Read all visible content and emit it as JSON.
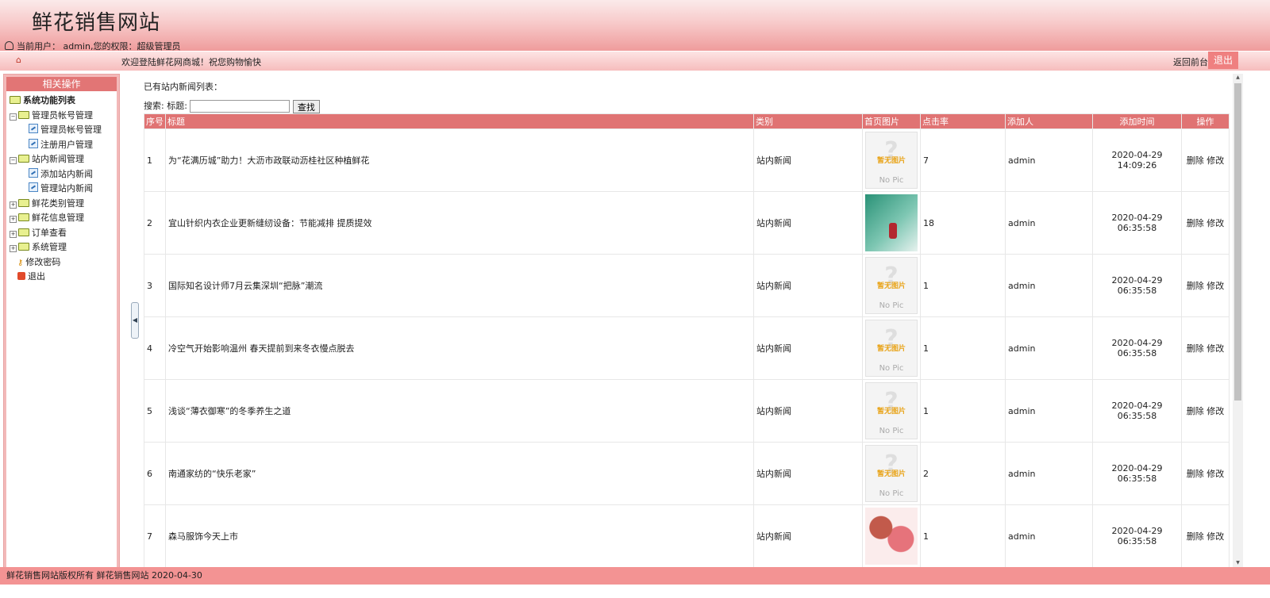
{
  "header": {
    "site_title": "鲜花销售网站",
    "user_info": "当前用户： admin,您的权限：超级管理员"
  },
  "nav": {
    "home_icon": "⌂",
    "welcome": "欢迎登陆鲜花网商城！祝您购物愉快",
    "back_front": "返回前台",
    "logout": "退出"
  },
  "sidebar": {
    "title": "相关操作",
    "root": "系统功能列表",
    "groups": [
      {
        "label": "管理员帐号管理",
        "children": [
          "管理员帐号管理",
          "注册用户管理"
        ]
      },
      {
        "label": "站内新闻管理",
        "children": [
          "添加站内新闻",
          "管理站内新闻"
        ]
      },
      {
        "label": "鲜花类别管理"
      },
      {
        "label": "鲜花信息管理"
      },
      {
        "label": "订单查看"
      },
      {
        "label": "系统管理"
      }
    ],
    "change_password": "修改密码",
    "exit": "退出"
  },
  "main": {
    "list_title": "已有站内新闻列表：",
    "search_label": "搜索: 标题:",
    "search_value": "",
    "search_button": "查找",
    "columns": [
      "序号",
      "标题",
      "类别",
      "首页图片",
      "点击率",
      "添加人",
      "添加时间",
      "操作"
    ],
    "nopic_text1": "暂无图片",
    "nopic_text2": "No Pic",
    "op_delete": "删除",
    "op_edit": "修改",
    "rows": [
      {
        "no": "1",
        "title": "为“花满历城”助力！大沥市政联动沥桂社区种植鲜花",
        "category": "站内新闻",
        "image": "nopic",
        "clicks": "7",
        "author": "admin",
        "time": "2020-04-29 14:09:26"
      },
      {
        "no": "2",
        "title": "宜山针织内衣企业更新缝纫设备：节能减排 提质提效",
        "category": "站内新闻",
        "image": "photo-green",
        "clicks": "18",
        "author": "admin",
        "time": "2020-04-29 06:35:58"
      },
      {
        "no": "3",
        "title": "国际知名设计师7月云集深圳“把脉”潮流",
        "category": "站内新闻",
        "image": "nopic",
        "clicks": "1",
        "author": "admin",
        "time": "2020-04-29 06:35:58"
      },
      {
        "no": "4",
        "title": "冷空气开始影响温州 春天提前到来冬衣慢点脱去",
        "category": "站内新闻",
        "image": "nopic",
        "clicks": "1",
        "author": "admin",
        "time": "2020-04-29 06:35:58"
      },
      {
        "no": "5",
        "title": "浅谈“薄衣御寒”的冬季养生之道",
        "category": "站内新闻",
        "image": "nopic",
        "clicks": "1",
        "author": "admin",
        "time": "2020-04-29 06:35:58"
      },
      {
        "no": "6",
        "title": "南通家纺的“快乐老家”",
        "category": "站内新闻",
        "image": "nopic",
        "clicks": "2",
        "author": "admin",
        "time": "2020-04-29 06:35:58"
      },
      {
        "no": "7",
        "title": "森马服饰今天上市",
        "category": "站内新闻",
        "image": "photo-flower",
        "clicks": "1",
        "author": "admin",
        "time": "2020-04-29 06:35:58"
      }
    ]
  },
  "footer": {
    "text": "鲜花销售网站版权所有  鲜花销售网站 2020-04-30"
  },
  "colors": {
    "accent": "#e07373",
    "footer": "#f39393",
    "logout_button": "#ef8080"
  }
}
